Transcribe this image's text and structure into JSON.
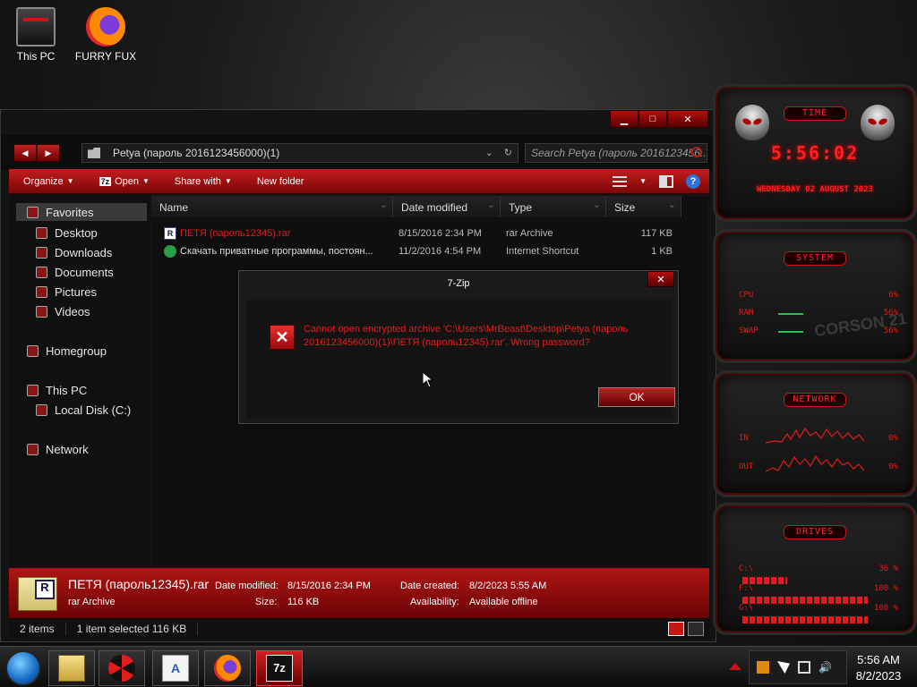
{
  "desktop": {
    "icons": [
      {
        "label": "This PC",
        "icon": "computer-icon"
      },
      {
        "label": "FURRY FUX",
        "icon": "firefox-icon"
      }
    ]
  },
  "explorer": {
    "controls": {
      "minimize": "▁",
      "maximize": "□",
      "close": "✕"
    },
    "nav_buttons": {
      "back": "◀",
      "forward": "▶"
    },
    "address": "Petya (пароль 2016123456000)(1)",
    "search_placeholder": "Search Petya (пароль 2016123456...",
    "toolbar": {
      "organize": "Organize",
      "open": "Open",
      "open_badge": "7z",
      "share_with": "Share with",
      "new_folder": "New folder",
      "help": "?"
    },
    "nav_pane": {
      "favorites": "Favorites",
      "desktop": "Desktop",
      "downloads": "Downloads",
      "documents": "Documents",
      "pictures": "Pictures",
      "videos": "Videos",
      "homegroup": "Homegroup",
      "this_pc": "This PC",
      "local_disk": "Local Disk (C:)",
      "network": "Network"
    },
    "columns": {
      "name": "Name",
      "date": "Date modified",
      "type": "Type",
      "size": "Size"
    },
    "files": [
      {
        "name": "ПЕТЯ (пароль12345).rar",
        "date": "8/15/2016 2:34 PM",
        "type": "rar Archive",
        "size": "117 KB",
        "icon": "rar-icon"
      },
      {
        "name": "Скачать приватные программы, постоян...",
        "date": "11/2/2016 4:54 PM",
        "type": "Internet Shortcut",
        "size": "1 KB",
        "icon": "url-shortcut-icon"
      }
    ],
    "details": {
      "name": "ПЕТЯ (пароль12345).rar",
      "kind": "rar Archive",
      "date_modified_label": "Date modified:",
      "date_modified": "8/15/2016 2:34 PM",
      "size_label": "Size:",
      "size": "116 KB",
      "date_created_label": "Date created:",
      "date_created": "8/2/2023 5:55 AM",
      "availability_label": "Availability:",
      "availability": "Available offline"
    },
    "status": {
      "items": "2 items",
      "selected": "1 item selected  116 KB"
    }
  },
  "dialog": {
    "title": "7-Zip",
    "close": "✕",
    "error_icon": "✕",
    "message": "Cannot open encrypted archive 'C:\\Users\\MrBeast\\Desktop\\Petya (пароль 2016123456000)(1)\\ПЕТЯ (пароль12345).rar'. Wrong password?",
    "ok": "OK"
  },
  "gadgets": {
    "time": {
      "title": "TIME",
      "clock": "5:56:02",
      "date": "WEDNESDAY 02 AUGUST 2023"
    },
    "system": {
      "title": "SYSTEM",
      "watermark": "CORSON 21",
      "cpu": {
        "label": "CPU",
        "value": "6%"
      },
      "ram": {
        "label": "RAM",
        "value": "56%"
      },
      "swap": {
        "label": "SWAP",
        "value": "56%"
      }
    },
    "network": {
      "title": "NETWORK",
      "in": {
        "label": "IN",
        "value": "0%"
      },
      "out": {
        "label": "OUT",
        "value": "0%"
      }
    },
    "drives": {
      "title": "DRIVES",
      "items": [
        {
          "label": "C:\\",
          "value": "36 %",
          "fill": 0.36
        },
        {
          "label": "F:\\",
          "value": "100 %",
          "fill": 1.0
        },
        {
          "label": "G:\\",
          "value": "100 %",
          "fill": 1.0
        }
      ]
    }
  },
  "taskbar": {
    "apps": [
      {
        "name": "file-explorer",
        "label": ""
      },
      {
        "name": "radiation-app",
        "label": ""
      },
      {
        "name": "wordpad",
        "label": "A"
      },
      {
        "name": "firefox",
        "label": ""
      },
      {
        "name": "7-zip",
        "label": "7z"
      }
    ],
    "clock": {
      "time": "5:56 AM",
      "date": "8/2/2023"
    }
  }
}
